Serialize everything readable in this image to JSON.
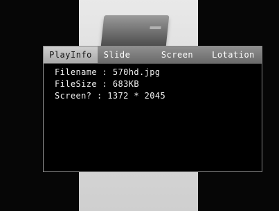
{
  "osd": {
    "tabs": [
      {
        "label": "PlayInfo",
        "active": true
      },
      {
        "label": "Slide",
        "active": false
      },
      {
        "label": "Screen",
        "active": false
      },
      {
        "label": "Lotation",
        "active": false
      }
    ],
    "info_lines": [
      "Filename : 570hd.jpg",
      "FileSize : 683KB",
      "Screen? : 1372 * 2045"
    ]
  },
  "colors": {
    "background": "#050505",
    "tab_bar": "#7a7a7a",
    "tab_active": "#bdbdbd",
    "text": "#f2f2f2"
  }
}
